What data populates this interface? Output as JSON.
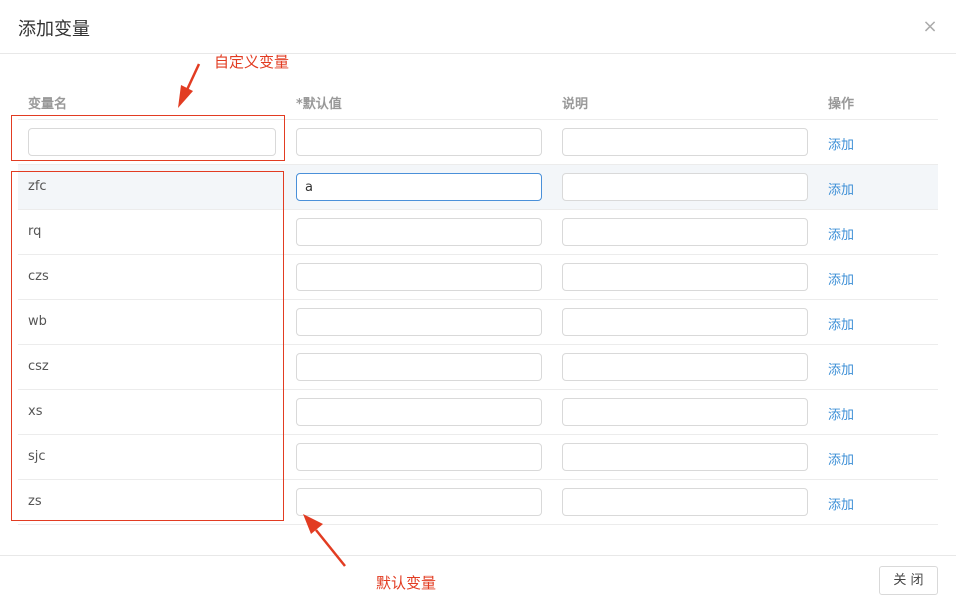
{
  "dialog": {
    "title": "添加变量",
    "close_icon": "×",
    "close_button_label": "关 闭"
  },
  "table": {
    "headers": {
      "name": "变量名",
      "default": "*默认值",
      "description": "说明",
      "action": "操作"
    },
    "add_label": "添加",
    "new_row": {
      "name": "",
      "default": "",
      "description": ""
    },
    "rows": [
      {
        "name": "zfc",
        "default": "a",
        "description": ""
      },
      {
        "name": "rq",
        "default": "",
        "description": ""
      },
      {
        "name": "czs",
        "default": "",
        "description": ""
      },
      {
        "name": "wb",
        "default": "",
        "description": ""
      },
      {
        "name": "csz",
        "default": "",
        "description": ""
      },
      {
        "name": "xs",
        "default": "",
        "description": ""
      },
      {
        "name": "sjc",
        "default": "",
        "description": ""
      },
      {
        "name": "zs",
        "default": "",
        "description": ""
      }
    ]
  },
  "annotations": {
    "custom_label": "自定义变量",
    "default_label": "默认变量",
    "color": "#e23c22"
  },
  "colors": {
    "link": "#3d8fd6",
    "focus_border": "#4a90d9",
    "active_row_bg": "#f3f6f9"
  }
}
